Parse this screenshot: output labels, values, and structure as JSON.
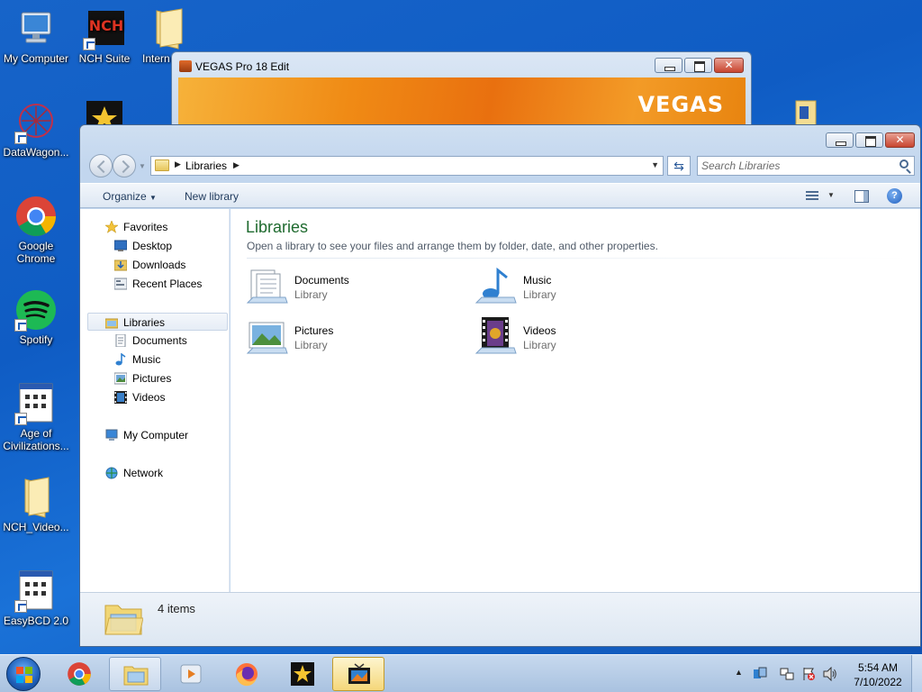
{
  "desktop": {
    "icons": [
      {
        "label": "My Computer"
      },
      {
        "label": "NCH Suite"
      },
      {
        "label": "Intern"
      },
      {
        "label": "DataWagon..."
      },
      {
        "label": "Google\nChrome"
      },
      {
        "label": "Spotify"
      },
      {
        "label": "Age of\nCivilizations..."
      },
      {
        "label": "NCH_Video..."
      },
      {
        "label": "EasyBCD 2.0"
      }
    ]
  },
  "vegas_window": {
    "title": "VEGAS Pro 18 Edit",
    "banner_logo": "VEGAS"
  },
  "explorer": {
    "address": {
      "crumb": "Libraries"
    },
    "search": {
      "placeholder": "Search Libraries"
    },
    "toolbar": {
      "organize": "Organize",
      "new_library": "New library"
    },
    "nav_pane": {
      "favorites": "Favorites",
      "favorites_items": [
        "Desktop",
        "Downloads",
        "Recent Places"
      ],
      "libraries": "Libraries",
      "libraries_items": [
        "Documents",
        "Music",
        "Pictures",
        "Videos"
      ],
      "my_computer": "My Computer",
      "network": "Network"
    },
    "content": {
      "heading": "Libraries",
      "subtitle": "Open a library to see your files and arrange them by folder, date, and other properties.",
      "libraries": [
        {
          "name": "Documents",
          "type": "Library"
        },
        {
          "name": "Music",
          "type": "Library"
        },
        {
          "name": "Pictures",
          "type": "Library"
        },
        {
          "name": "Videos",
          "type": "Library"
        }
      ]
    },
    "details": {
      "count": "4 items"
    }
  },
  "taskbar": {
    "apps": [
      "windows-explorer",
      "chrome",
      "nch-video",
      "firefox",
      "movie-maker",
      "vegas"
    ],
    "clock": {
      "time": "5:54 AM",
      "date": "7/10/2022"
    }
  },
  "colors": {
    "desktop_bg": "#1764c9",
    "library_heading": "#1e6a2e",
    "vegas_orange": "#f08b15"
  }
}
